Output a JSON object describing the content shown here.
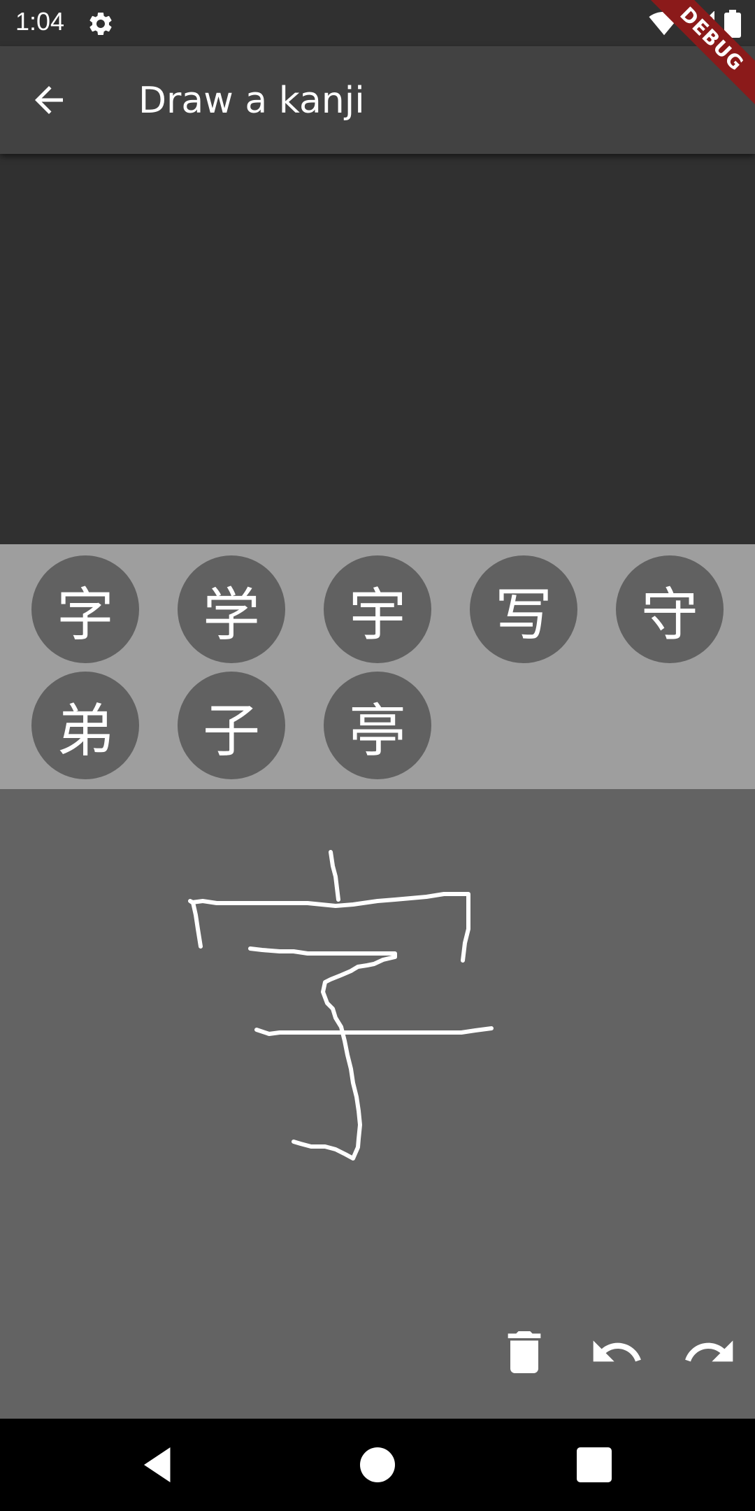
{
  "status_bar": {
    "time": "1:04",
    "icons": [
      "gear-icon",
      "wifi-icon",
      "signal-icon",
      "battery-icon"
    ]
  },
  "app_bar": {
    "title": "Draw a kanji",
    "back_icon": "arrow-back-icon",
    "debug_label": "DEBUG"
  },
  "candidates": [
    "字",
    "学",
    "宇",
    "写",
    "守",
    "弟",
    "子",
    "亭"
  ],
  "drawing_tools": [
    {
      "name": "delete",
      "icon": "trash-icon"
    },
    {
      "name": "undo",
      "icon": "undo-icon"
    },
    {
      "name": "redo",
      "icon": "redo-icon"
    }
  ],
  "nav_bar": [
    "back-triangle-icon",
    "home-circle-icon",
    "recents-square-icon"
  ],
  "colors": {
    "status_bar": "#303030",
    "app_bar": "#424242",
    "result_area": "#303030",
    "candidate_panel": "#9e9e9e",
    "candidate_circle": "#616161",
    "draw_area": "#636363",
    "stroke": "#ffffff",
    "debug_banner": "#8b1a1a"
  }
}
